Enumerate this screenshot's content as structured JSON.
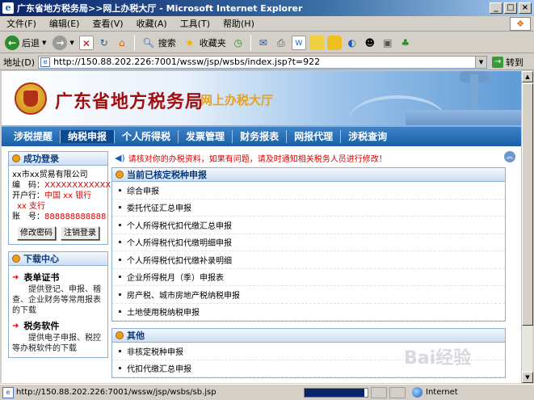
{
  "window": {
    "title": "广东省地方税务局>>网上办税大厅 - Microsoft Internet Explorer",
    "app_icon": "e"
  },
  "menu": {
    "items": [
      "文件(F)",
      "编辑(E)",
      "查看(V)",
      "收藏(A)",
      "工具(T)",
      "帮助(H)"
    ]
  },
  "toolbar": {
    "back_label": "后退",
    "search_label": "搜索",
    "favorites_label": "收藏夹"
  },
  "address": {
    "label": "地址(D)",
    "url": "http://150.88.202.226:7001/wssw/jsp/wsbs/index.jsp?t=922",
    "go_label": "转到"
  },
  "banner": {
    "bureau_name": "广东省地方税务局",
    "hall_name": "网上办税大厅"
  },
  "nav": {
    "items": [
      "涉税提醒",
      "纳税申报",
      "个人所得税",
      "发票管理",
      "财务报表",
      "网报代理",
      "涉税查询"
    ],
    "active_index": 1
  },
  "login": {
    "title": "成功登录",
    "company": "xx市xx贸易有限公司",
    "code_label": "编　码：",
    "code_value": "XXXXXXXXXXXX",
    "bank_label": "开户行：",
    "bank_value": "中国 xx 银行",
    "branch_value": "xx 支行",
    "account_label": "账　号：",
    "account_value": "888888888888",
    "change_password_button": "修改密码",
    "logout_button": "注销登录"
  },
  "download": {
    "title": "下载中心",
    "forms_title": "表单证书",
    "forms_desc": "提供登记、申报、稽查、企业财务等常用报表的下载",
    "software_title": "税务软件",
    "software_desc": "提供电子申报、税控等办税软件的下载"
  },
  "notice": {
    "text": "请核对你的办税资料，如果有问题，请及时通知相关税务人员进行修改！"
  },
  "approved_section": {
    "title": "当前已核定税种申报",
    "items": [
      "综合申报",
      "委托代征汇总申报",
      "个人所得税代扣代缴汇总申报",
      "个人所得税代扣代缴明细申报",
      "个人所得税代扣代缴补录明细",
      "企业所得税月（季）申报表",
      "房产税、城市房地产税纳税申报",
      "土地使用税纳税申报"
    ]
  },
  "other_section": {
    "title": "其他",
    "items": [
      "非核定税种申报",
      "代扣代缴汇总申报"
    ]
  },
  "status": {
    "url": "http://150.88.202.226:7001/wssw/jsp/wsbs/sb.jsp",
    "zone": "Internet",
    "progress": 0.95
  },
  "watermark": "Bai经验"
}
